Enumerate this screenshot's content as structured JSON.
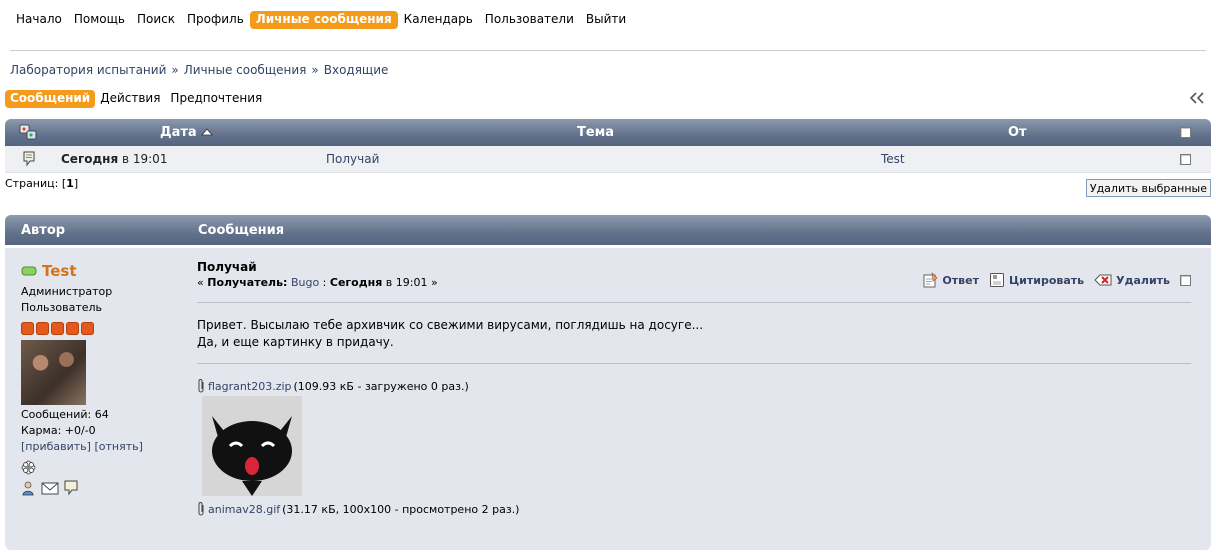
{
  "topmenu": [
    {
      "label": "Начало",
      "active": false
    },
    {
      "label": "Помощь",
      "active": false
    },
    {
      "label": "Поиск",
      "active": false
    },
    {
      "label": "Профиль",
      "active": false
    },
    {
      "label": "Личные сообщения",
      "active": true
    },
    {
      "label": "Календарь",
      "active": false
    },
    {
      "label": "Пользователи",
      "active": false
    },
    {
      "label": "Выйти",
      "active": false
    }
  ],
  "breadcrumb": [
    "Лаборатория испытаний",
    "Личные сообщения",
    "Входящие"
  ],
  "breadcrumb_sep": "»",
  "subtabs": [
    {
      "label": "Сообщений",
      "active": true
    },
    {
      "label": "Действия",
      "active": false
    },
    {
      "label": "Предпочтения",
      "active": false
    }
  ],
  "table": {
    "col_date": "Дата",
    "col_subject": "Тема",
    "col_from": "От",
    "rows": [
      {
        "date_bold": "Сегодня",
        "date_rest": "в 19:01",
        "subject": "Получай",
        "from": "Test"
      }
    ]
  },
  "pages": {
    "label": "Страниц:",
    "current": "1"
  },
  "delete_selected_label": "Удалить выбранные",
  "post": {
    "col_author": "Автор",
    "col_messages": "Сообщения",
    "author": {
      "name": "Test",
      "role": "Администратор",
      "group": "Пользователь",
      "stars": 5,
      "posts_label": "Сообщений: 64",
      "karma_label": "Карма: +0/-0",
      "karma_add": "[прибавить]",
      "karma_remove": "[отнять]"
    },
    "subject": "Получай",
    "meta_prefix": "« ",
    "recipient_label": "Получатель:",
    "recipient": "Bugo",
    "date_bold": "Сегодня",
    "date_rest": "в 19:01 »",
    "actions": {
      "reply": "Ответ",
      "quote": "Цитировать",
      "delete": "Удалить"
    },
    "body_lines": [
      "Привет. Высылаю тебе архивчик со свежими вирусами, поглядишь на досуге...",
      "Да, и еще картинку в придачу."
    ],
    "attachments": [
      {
        "name": "flagrant203.zip",
        "info": "(109.93 кБ - загружено 0 раз.)"
      },
      {
        "name": "animav28.gif",
        "info": "(31.17 кБ, 100x100 - просмотрено 2 раз.)"
      }
    ]
  },
  "colors": {
    "accent": "#f49b1b",
    "header_bar": "#63728b",
    "row_bg": "#eef0f4",
    "post_bg": "#e3e6ec",
    "author_name": "#d4731c"
  }
}
